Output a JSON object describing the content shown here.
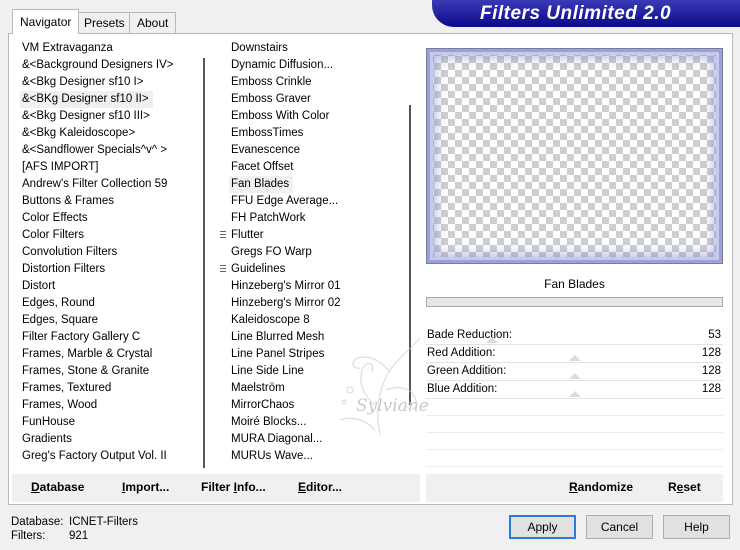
{
  "tabs": [
    {
      "label": "Navigator",
      "active": true
    },
    {
      "label": "Presets",
      "active": false
    },
    {
      "label": "About",
      "active": false
    }
  ],
  "title": "Filters Unlimited 2.0",
  "categories": {
    "items": [
      "VM Extravaganza",
      "&<Background Designers IV>",
      "&<Bkg Designer sf10 I>",
      "&<BKg Designer sf10 II>",
      "&<Bkg Designer sf10 III>",
      "&<Bkg Kaleidoscope>",
      "&<Sandflower Specials^v^ >",
      "[AFS IMPORT]",
      "Andrew's Filter Collection 59",
      "Buttons & Frames",
      "Color Effects",
      "Color Filters",
      "Convolution Filters",
      "Distortion Filters",
      "Distort",
      "Edges, Round",
      "Edges, Square",
      "Filter Factory Gallery C",
      "Frames, Marble & Crystal",
      "Frames, Stone & Granite",
      "Frames, Textured",
      "Frames, Wood",
      "FunHouse",
      "Gradients",
      "Greg's Factory Output Vol. II"
    ],
    "selected_index": 3
  },
  "filters": {
    "items": [
      "Downstairs",
      "Dynamic Diffusion...",
      "Emboss Crinkle",
      "Emboss Graver",
      "Emboss With Color",
      "EmbossTimes",
      "Evanescence",
      "Facet Offset",
      "Fan Blades",
      "FFU Edge Average...",
      "FH PatchWork",
      "Flutter",
      "Gregs FO Warp",
      "Guidelines",
      "Hinzeberg's Mirror 01",
      "Hinzeberg's Mirror 02",
      "Kaleidoscope 8",
      "Line Blurred Mesh",
      "Line Panel Stripes",
      "Line Side Line",
      "Maelström",
      "MirrorChaos",
      "Moiré Blocks...",
      "MURA Diagonal...",
      "MURUs Wave..."
    ],
    "selected_index": 8,
    "grip_indices": [
      11,
      13
    ]
  },
  "preview": {
    "filter_name": "Fan Blades"
  },
  "params": [
    {
      "label": "Bade Reduction:",
      "value": "53",
      "fraction": 0.21
    },
    {
      "label": "Red Addition:",
      "value": "128",
      "fraction": 0.5
    },
    {
      "label": "Green Addition:",
      "value": "128",
      "fraction": 0.5
    },
    {
      "label": "Blue Addition:",
      "value": "128",
      "fraction": 0.5
    }
  ],
  "toolbar": {
    "database": {
      "key": "D",
      "rest": "atabase"
    },
    "import": {
      "key": "I",
      "rest": "mport..."
    },
    "filter_info": {
      "pre": "Filter ",
      "key": "I",
      "rest": "nfo..."
    },
    "editor": {
      "key": "E",
      "rest": "ditor..."
    },
    "randomize": {
      "key": "R",
      "rest": "andomize"
    },
    "reset": {
      "pre": "R",
      "key": "e",
      "rest": "set"
    }
  },
  "status": {
    "database_label": "Database:",
    "database_value": "ICNET-Filters",
    "filters_label": "Filters:",
    "filters_value": "921"
  },
  "buttons": {
    "apply": "Apply",
    "cancel": "Cancel",
    "help": "Help"
  },
  "watermark": "Sylviane",
  "colors": {
    "banner": "#0a0a8a",
    "default_button_border": "#2a7bd8"
  }
}
